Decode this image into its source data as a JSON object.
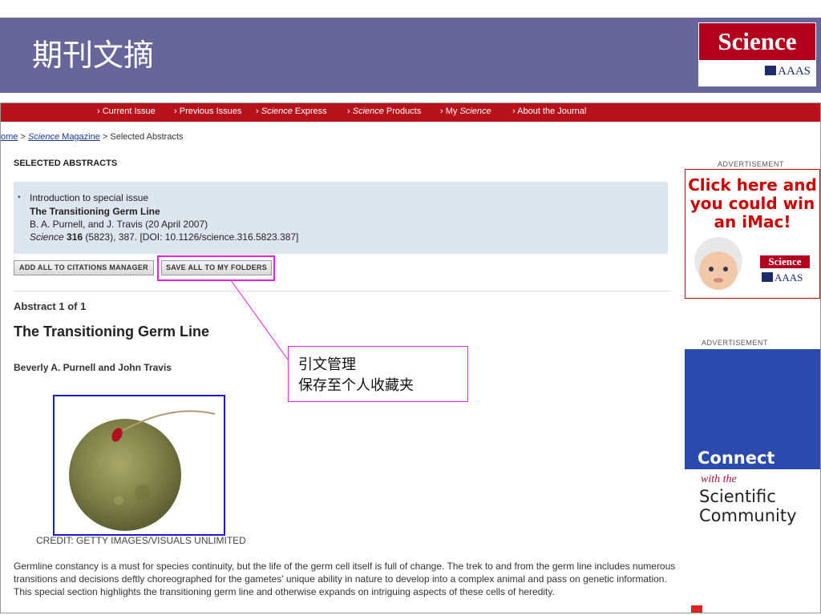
{
  "slide": {
    "title": "期刊文摘",
    "logo_text": "Science",
    "logo_sub": "AAAS"
  },
  "nav": [
    {
      "pre": "",
      "it": "",
      "post": "Current Issue"
    },
    {
      "pre": "",
      "it": "",
      "post": "Previous Issues"
    },
    {
      "pre": "",
      "it": "Science",
      "post": " Express"
    },
    {
      "pre": "",
      "it": "Science",
      "post": " Products"
    },
    {
      "pre": "My ",
      "it": "Science",
      "post": ""
    },
    {
      "pre": "",
      "it": "",
      "post": "About the Journal"
    }
  ],
  "breadcrumb": {
    "home": "ome",
    "sep1": " > ",
    "mag_it": "Science",
    "mag": " Magazine",
    "sep2": " > ",
    "current": "Selected Abstracts"
  },
  "selected": {
    "heading": "SELECTED ABSTRACTS",
    "item": {
      "section": "Introduction to special issue",
      "title": "The Transitioning Germ Line",
      "authors": "B. A. Purnell, and J. Travis (20 April 2007)",
      "journal": "Science",
      "volume": "316",
      "citation_rest": " (5823), 387. [DOI: 10.1126/science.316.5823.387]"
    }
  },
  "buttons": {
    "add_citations": "ADD ALL TO CITATIONS MANAGER",
    "save_folders": "SAVE ALL TO MY FOLDERS"
  },
  "callout": {
    "line1": "引文管理",
    "line2": "保存至个人收藏夹"
  },
  "abstract": {
    "count": "Abstract 1 of 1",
    "title": "The Transitioning Germ Line",
    "authors": "Beverly A. Purnell and John Travis",
    "credit": "CREDIT: GETTY IMAGES/VISUALS UNLIMITED",
    "body": "Germline constancy is a must for species continuity, but the life of the germ cell itself is full of change. The trek to and from the germ line includes numerous transitions and decisions deftly choreographed for the gametes' unique ability in nature to develop into a complex animal and pass on genetic information. This special section highlights the transitioning germ line and otherwise expands on intriguing aspects of these cells of heredity."
  },
  "ads": {
    "label": "ADVERTISEMENT",
    "ad1_line1": "Click here and",
    "ad1_line2": "you could win",
    "ad1_line3": "an iMac!",
    "ad1_science": "Science",
    "ad1_aaas": "AAAS",
    "ad2_connect": "Connect",
    "ad2_with": "with the",
    "ad2_line1": "Scientific",
    "ad2_line2": "Community"
  }
}
